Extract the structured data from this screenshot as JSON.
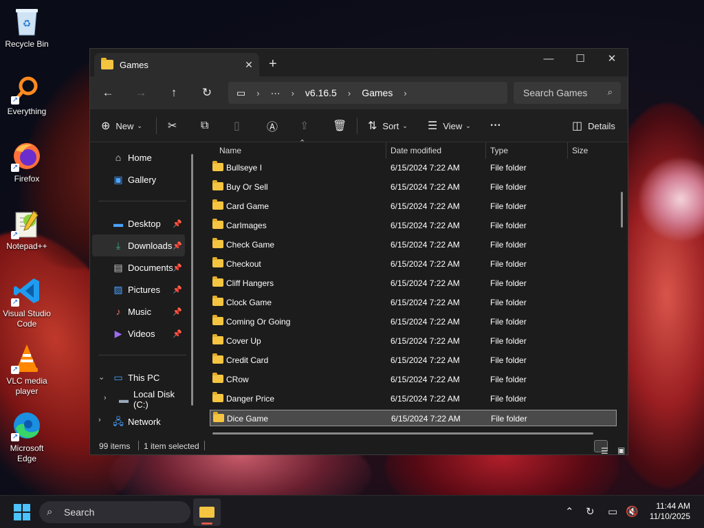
{
  "desktop": {
    "icons": [
      {
        "label": "Recycle Bin",
        "icon": "recycle-bin-icon"
      },
      {
        "label": "Everything",
        "icon": "everything-search-icon"
      },
      {
        "label": "Firefox",
        "icon": "firefox-icon"
      },
      {
        "label": "Notepad++",
        "icon": "notepad-plus-plus-icon"
      },
      {
        "label": "Visual Studio Code",
        "icon": "vscode-icon"
      },
      {
        "label": "VLC media player",
        "icon": "vlc-icon"
      },
      {
        "label": "Microsoft Edge",
        "icon": "edge-icon"
      }
    ]
  },
  "window": {
    "tab_title": "Games",
    "address": {
      "ellipsis": "···",
      "segments": [
        "v6.16.5",
        "Games"
      ]
    },
    "search_placeholder": "Search Games",
    "commands": {
      "new": "New",
      "sort": "Sort",
      "view": "View",
      "more": "···",
      "details": "Details"
    },
    "sidebar": {
      "quick": [
        {
          "label": "Home",
          "icon": "home-icon"
        },
        {
          "label": "Gallery",
          "icon": "gallery-icon"
        }
      ],
      "pinned": [
        {
          "label": "Desktop",
          "icon": "desktop-folder-icon"
        },
        {
          "label": "Downloads",
          "icon": "downloads-icon"
        },
        {
          "label": "Documents",
          "icon": "documents-icon"
        },
        {
          "label": "Pictures",
          "icon": "pictures-icon"
        },
        {
          "label": "Music",
          "icon": "music-icon"
        },
        {
          "label": "Videos",
          "icon": "videos-icon"
        }
      ],
      "tree": [
        {
          "label": "This PC",
          "icon": "this-pc-icon"
        },
        {
          "label": "Local Disk (C:)",
          "icon": "local-disk-icon"
        },
        {
          "label": "Network",
          "icon": "network-icon"
        }
      ]
    },
    "columns": [
      "Name",
      "Date modified",
      "Type",
      "Size"
    ],
    "files": [
      {
        "name": "Bullseye I",
        "date": "6/15/2024 7:22 AM",
        "type": "File folder"
      },
      {
        "name": "Buy Or Sell",
        "date": "6/15/2024 7:22 AM",
        "type": "File folder"
      },
      {
        "name": "Card Game",
        "date": "6/15/2024 7:22 AM",
        "type": "File folder"
      },
      {
        "name": "CarImages",
        "date": "6/15/2024 7:22 AM",
        "type": "File folder"
      },
      {
        "name": "Check Game",
        "date": "6/15/2024 7:22 AM",
        "type": "File folder"
      },
      {
        "name": "Checkout",
        "date": "6/15/2024 7:22 AM",
        "type": "File folder"
      },
      {
        "name": "Cliff Hangers",
        "date": "6/15/2024 7:22 AM",
        "type": "File folder"
      },
      {
        "name": "Clock Game",
        "date": "6/15/2024 7:22 AM",
        "type": "File folder"
      },
      {
        "name": "Coming Or Going",
        "date": "6/15/2024 7:22 AM",
        "type": "File folder"
      },
      {
        "name": "Cover Up",
        "date": "6/15/2024 7:22 AM",
        "type": "File folder"
      },
      {
        "name": "Credit Card",
        "date": "6/15/2024 7:22 AM",
        "type": "File folder"
      },
      {
        "name": "CRow",
        "date": "6/15/2024 7:22 AM",
        "type": "File folder"
      },
      {
        "name": "Danger Price",
        "date": "6/15/2024 7:22 AM",
        "type": "File folder"
      },
      {
        "name": "Dice Game",
        "date": "6/15/2024 7:22 AM",
        "type": "File folder"
      }
    ],
    "selected_row": 13,
    "status": {
      "items": "99 items",
      "selected": "1 item selected"
    }
  },
  "taskbar": {
    "search_label": "Search",
    "time": "11:44 AM",
    "date": "11/10/2025"
  },
  "colors": {
    "accent": "#4cc2ff",
    "folder": "#f5c542",
    "window_bg": "#1c1c1c"
  }
}
